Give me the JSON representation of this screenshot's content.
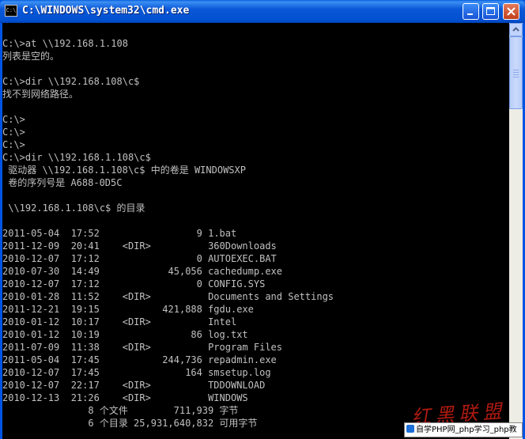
{
  "window": {
    "title": "C:\\WINDOWS\\system32\\cmd.exe",
    "icon_text": "C:\\"
  },
  "console_lines": [
    "",
    "C:\\>at \\\\192.168.1.108",
    "列表是空的。",
    "",
    "C:\\>dir \\\\192.168.108\\c$",
    "找不到网络路径。",
    "",
    "C:\\>",
    "C:\\>",
    "C:\\>",
    "C:\\>dir \\\\192.168.1.108\\c$",
    " 驱动器 \\\\192.168.1.108\\c$ 中的卷是 WINDOWSXP",
    " 卷的序列号是 A688-0D5C",
    "",
    " \\\\192.168.1.108\\c$ 的目录",
    "",
    "2011-05-04  17:52                 9 1.bat",
    "2011-12-09  20:41    <DIR>          360Downloads",
    "2010-12-07  17:12                 0 AUTOEXEC.BAT",
    "2010-07-30  14:49            45,056 cachedump.exe",
    "2010-12-07  17:12                 0 CONFIG.SYS",
    "2010-01-28  11:52    <DIR>          Documents and Settings",
    "2011-12-21  19:15           421,888 fgdu.exe",
    "2010-01-12  10:17    <DIR>          Intel",
    "2010-01-12  10:19                86 log.txt",
    "2011-07-09  11:38    <DIR>          Program Files",
    "2011-05-04  17:45           244,736 repadmin.exe",
    "2010-12-07  17:45               164 smsetup.log",
    "2010-12-07  22:17    <DIR>          TDDOWNLOAD",
    "2010-12-13  21:26    <DIR>          WINDOWS",
    "               8 个文件        711,939 字节",
    "               6 个目录 25,931,640,832 可用字节"
  ],
  "watermark": {
    "text": "红黑联盟",
    "color": "#c21d12"
  },
  "footer": {
    "text": "自学PHP网_php学习_php教"
  },
  "colors": {
    "console_bg": "#000000",
    "console_fg": "#c0c0c0",
    "title_bar": "#0054e3"
  }
}
